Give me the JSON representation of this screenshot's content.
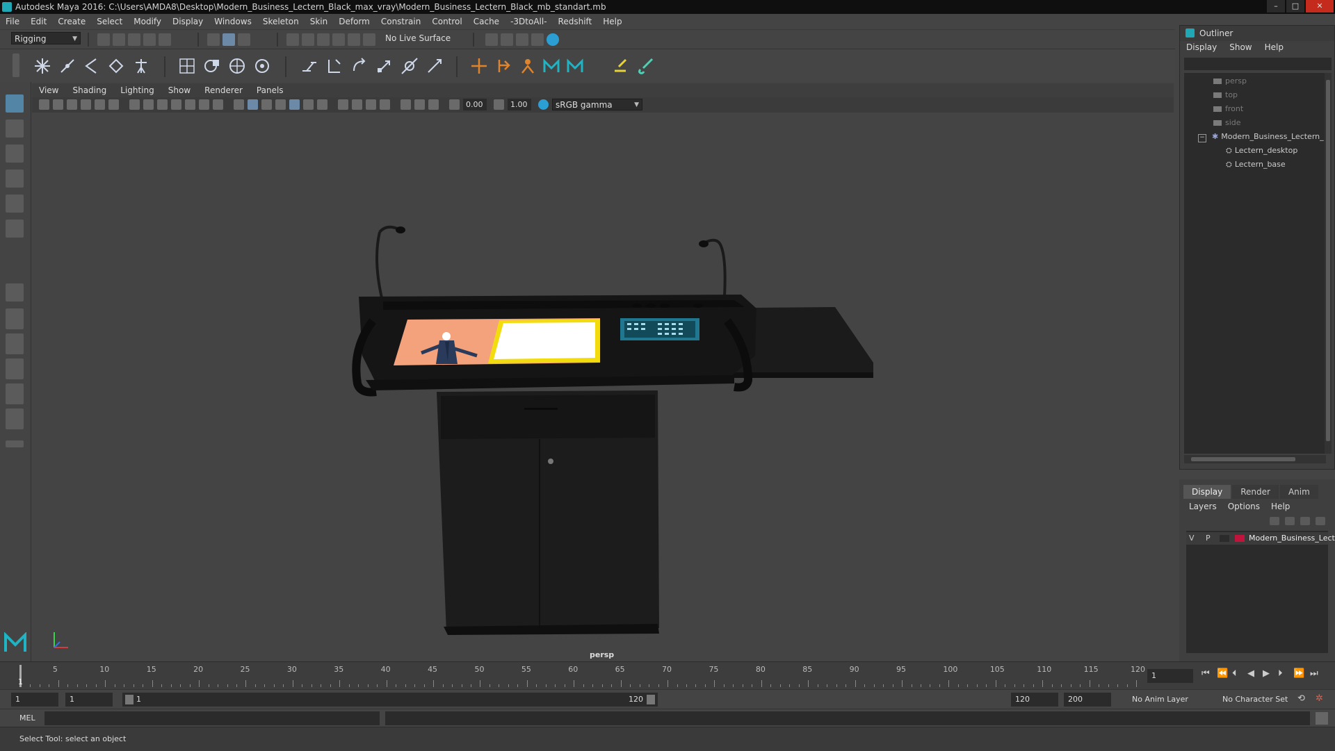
{
  "window": {
    "title": "Autodesk Maya 2016: C:\\Users\\AMDA8\\Desktop\\Modern_Business_Lectern_Black_max_vray\\Modern_Business_Lectern_Black_mb_standart.mb",
    "minimize": "–",
    "maximize": "□",
    "close": "✕"
  },
  "menubar": [
    "File",
    "Edit",
    "Create",
    "Select",
    "Modify",
    "Display",
    "Windows",
    "Skeleton",
    "Skin",
    "Deform",
    "Constrain",
    "Control",
    "Cache",
    "-3DtoAll-",
    "Redshift",
    "Help"
  ],
  "toolbar": {
    "mode": "Rigging",
    "live_surface": "No Live Surface"
  },
  "panel": {
    "menu": [
      "View",
      "Shading",
      "Lighting",
      "Show",
      "Renderer",
      "Panels"
    ],
    "exposure": "0.00",
    "gamma": "1.00",
    "colorspace": "sRGB gamma",
    "camera_label": "persp"
  },
  "outliner": {
    "title": "Outliner",
    "menu": [
      "Display",
      "Show",
      "Help"
    ],
    "items": [
      {
        "label": "persp"
      },
      {
        "label": "top"
      },
      {
        "label": "front"
      },
      {
        "label": "side"
      },
      {
        "label": "Modern_Business_Lectern_"
      },
      {
        "label": "Lectern_desktop"
      },
      {
        "label": "Lectern_base"
      }
    ]
  },
  "layer_editor": {
    "tabs": [
      "Display",
      "Render",
      "Anim"
    ],
    "menu": [
      "Layers",
      "Options",
      "Help"
    ],
    "layer": {
      "v": "V",
      "p": "P",
      "name": "Modern_Business_Lect",
      "color": "#c0143c"
    }
  },
  "timeline": {
    "ticks": [
      "5",
      "10",
      "15",
      "20",
      "25",
      "30",
      "35",
      "40",
      "45",
      "50",
      "55",
      "60",
      "65",
      "70",
      "75",
      "80",
      "85",
      "90",
      "95",
      "100",
      "105",
      "110",
      "115",
      "120"
    ],
    "first": "1",
    "current_frame": "1"
  },
  "range": {
    "start": "1",
    "playback_start": "1",
    "slider_start": "1",
    "slider_end": "120",
    "playback_end": "120",
    "end": "200",
    "anim_layer": "No Anim Layer",
    "character_set": "No Character Set"
  },
  "command": {
    "lang": "MEL"
  },
  "status": {
    "help": "Select Tool: select an object"
  }
}
